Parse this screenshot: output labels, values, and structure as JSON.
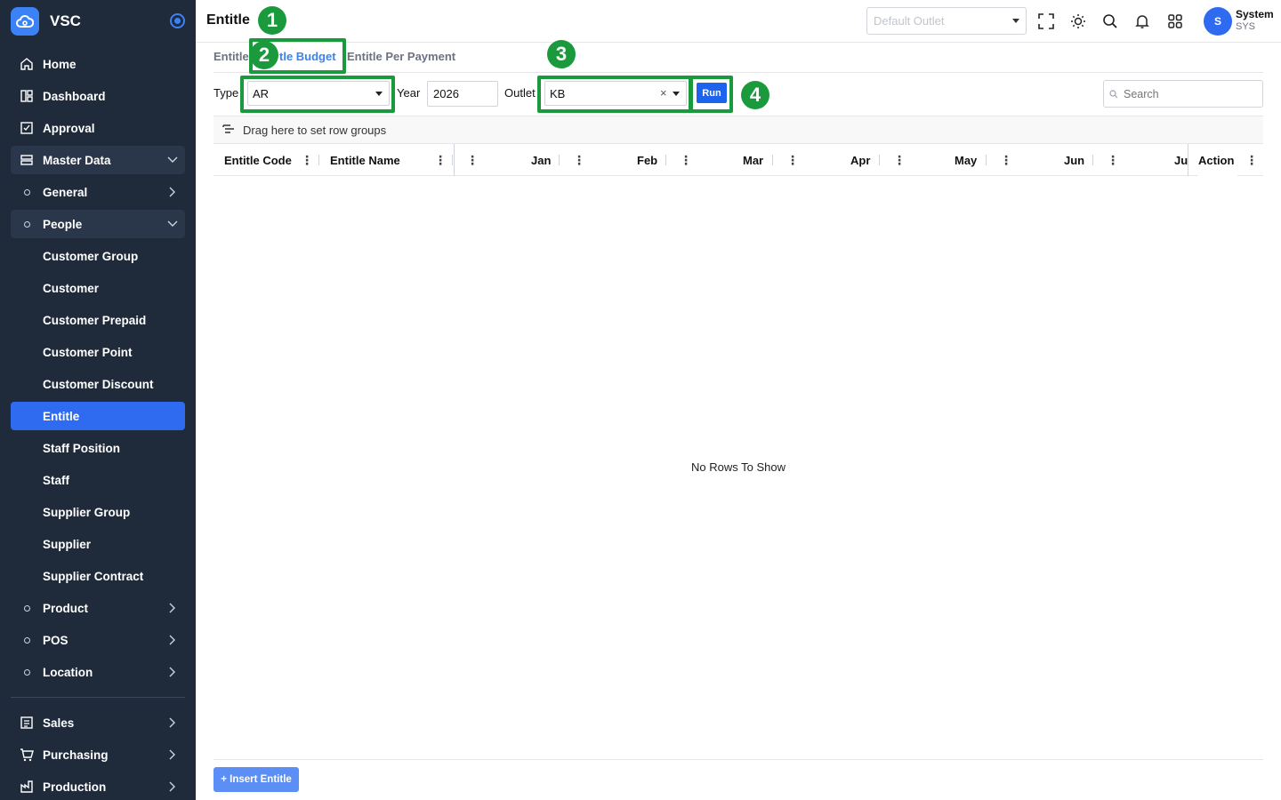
{
  "brand": {
    "name": "VSC"
  },
  "sidebar": {
    "items": [
      {
        "label": "Home"
      },
      {
        "label": "Dashboard"
      },
      {
        "label": "Approval"
      },
      {
        "label": "Master Data"
      },
      {
        "label": "General"
      },
      {
        "label": "People"
      },
      {
        "label": "Customer Group"
      },
      {
        "label": "Customer"
      },
      {
        "label": "Customer Prepaid"
      },
      {
        "label": "Customer Point"
      },
      {
        "label": "Customer Discount"
      },
      {
        "label": "Entitle"
      },
      {
        "label": "Staff Position"
      },
      {
        "label": "Staff"
      },
      {
        "label": "Supplier Group"
      },
      {
        "label": "Supplier"
      },
      {
        "label": "Supplier Contract"
      },
      {
        "label": "Product"
      },
      {
        "label": "POS"
      },
      {
        "label": "Location"
      },
      {
        "label": "Sales"
      },
      {
        "label": "Purchasing"
      },
      {
        "label": "Production"
      }
    ]
  },
  "header": {
    "title": "Entitle",
    "outlet_placeholder": "Default Outlet",
    "user": {
      "initial": "S",
      "name": "System",
      "code": "SYS"
    }
  },
  "tabs": [
    {
      "label": "Entitle"
    },
    {
      "label": "tle Budget"
    },
    {
      "label": "Entitle Per Payment"
    }
  ],
  "filters": {
    "type_label": "Type",
    "type_value": "AR",
    "year_label": "Year",
    "year_value": "2026",
    "outlet_label": "Outlet",
    "outlet_value": "KB",
    "run_label": "Run",
    "search_placeholder": "Search"
  },
  "markers": [
    "1",
    "2",
    "3",
    "4"
  ],
  "grid": {
    "group_hint": "Drag here to set row groups",
    "columns": [
      "Entitle Code",
      "Entitle Name",
      "Jan",
      "Feb",
      "Mar",
      "Apr",
      "May",
      "Jun",
      "Ju",
      "Action"
    ],
    "empty_text": "No Rows To Show"
  },
  "footer": {
    "insert_label": "+ Insert Entitle"
  },
  "colors": {
    "sidebar_bg": "#1f2a3b",
    "accent": "#2f6bf0",
    "highlight": "#1a9a3c"
  }
}
